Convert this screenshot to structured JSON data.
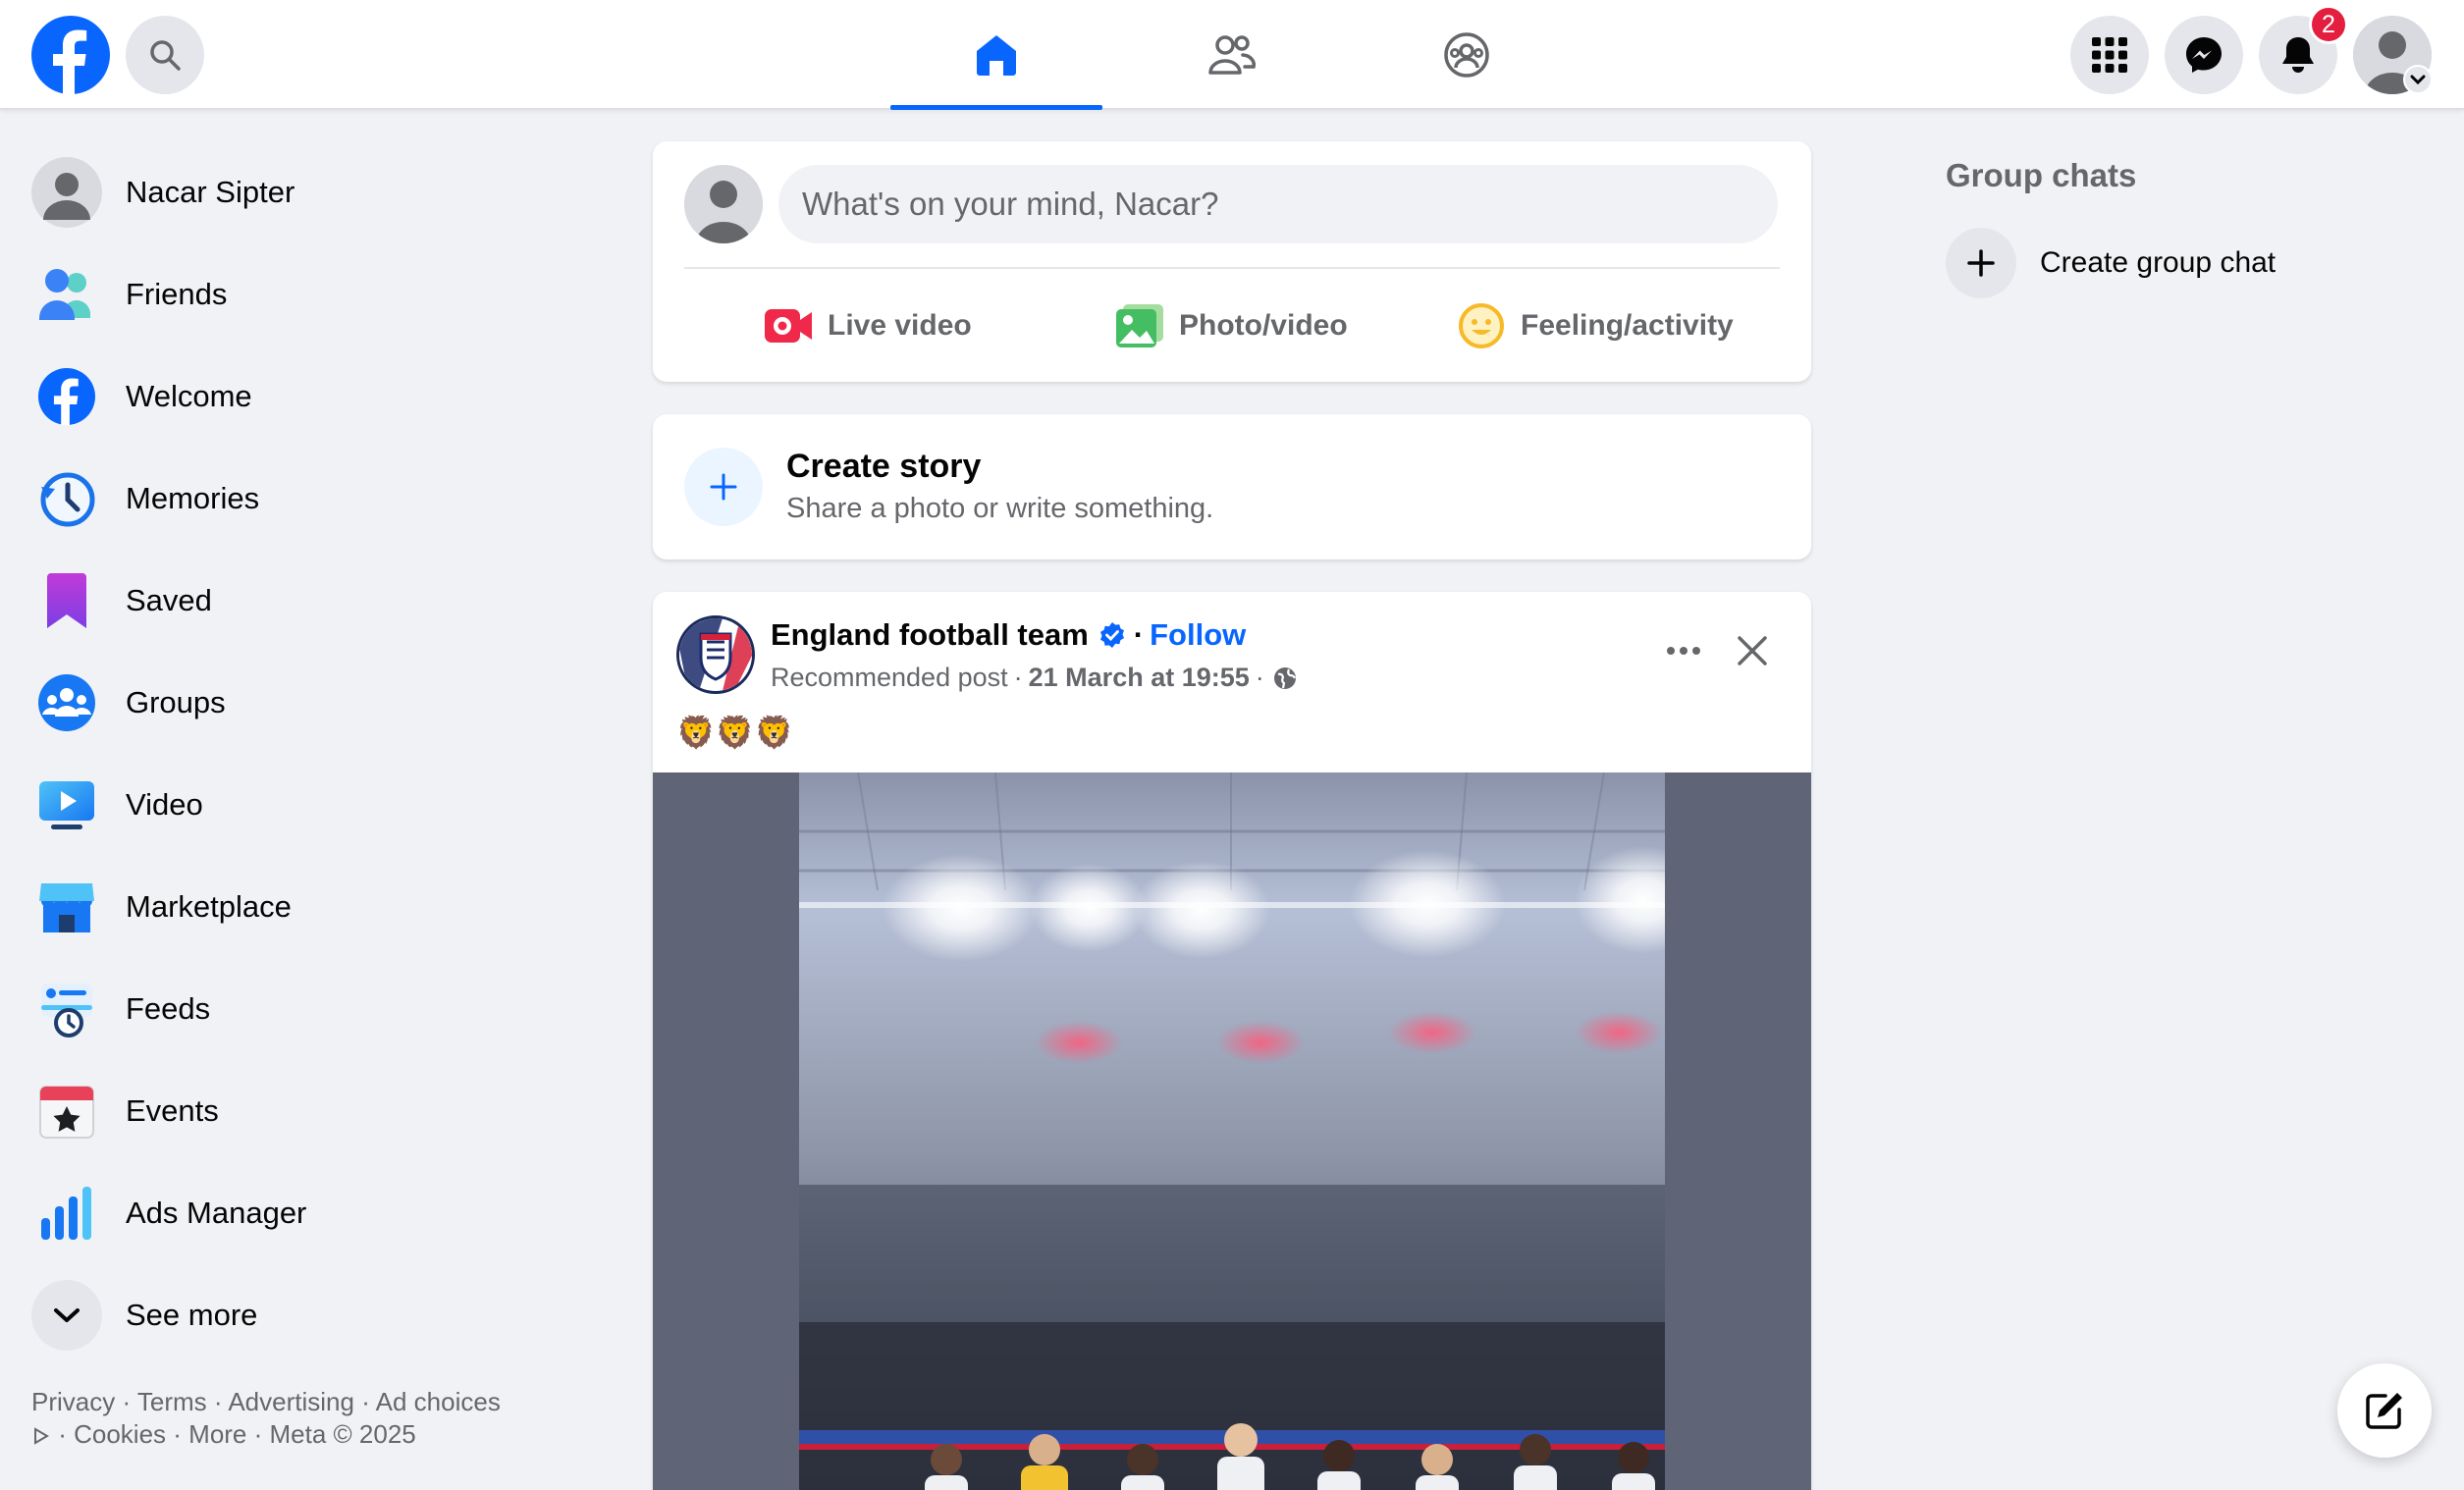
{
  "colors": {
    "brand_blue": "#0866ff",
    "notification_red": "#e41e3f",
    "secondary_text": "#65676b",
    "background": "#f0f2f5"
  },
  "topbar": {
    "logo_icon": "facebook-logo-icon",
    "search_icon": "search-icon",
    "tabs": [
      {
        "name": "home",
        "icon": "home-icon",
        "active": true
      },
      {
        "name": "friends",
        "icon": "friends-icon",
        "active": false
      },
      {
        "name": "groups",
        "icon": "groups-icon",
        "active": false
      }
    ],
    "menu_icon": "grid-menu-icon",
    "messenger_icon": "messenger-icon",
    "notifications_icon": "bell-icon",
    "notification_count": "2",
    "profile_icon": "avatar-icon"
  },
  "sidebar": {
    "profile_name": "Nacar Sipter",
    "items": [
      {
        "label": "Friends",
        "icon": "friends-icon"
      },
      {
        "label": "Welcome",
        "icon": "facebook-logo-icon"
      },
      {
        "label": "Memories",
        "icon": "memories-clock-icon"
      },
      {
        "label": "Saved",
        "icon": "bookmark-icon"
      },
      {
        "label": "Groups",
        "icon": "groups-icon"
      },
      {
        "label": "Video",
        "icon": "video-icon"
      },
      {
        "label": "Marketplace",
        "icon": "marketplace-icon"
      },
      {
        "label": "Feeds",
        "icon": "feeds-icon"
      },
      {
        "label": "Events",
        "icon": "events-icon"
      },
      {
        "label": "Ads Manager",
        "icon": "ads-manager-icon"
      }
    ],
    "see_more": "See more",
    "footer": {
      "privacy": "Privacy",
      "terms": "Terms",
      "advertising": "Advertising",
      "ad_choices": "Ad choices",
      "cookies": "Cookies",
      "more": "More",
      "meta": "Meta © 2025"
    }
  },
  "composer": {
    "placeholder": "What's on your mind, Nacar?",
    "live_video": "Live video",
    "photo_video": "Photo/video",
    "feeling": "Feeling/activity"
  },
  "story": {
    "title": "Create story",
    "subtitle": "Share a photo or write something."
  },
  "post": {
    "author": "England football team",
    "follow": "Follow",
    "meta_label": "Recommended post",
    "date": "21 March at 19:55",
    "text": "🦁🦁🦁",
    "image_alt": "England team lineup in stadium"
  },
  "right_rail": {
    "title": "Group chats",
    "create_group_chat": "Create group chat"
  }
}
